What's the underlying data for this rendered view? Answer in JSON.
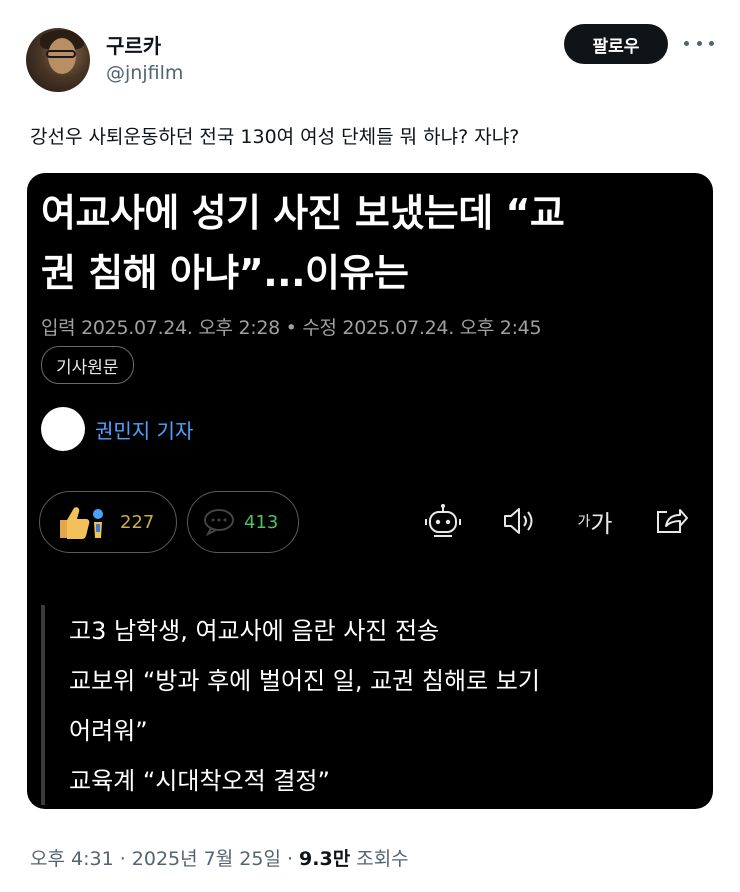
{
  "author": {
    "display_name": "구르카",
    "handle": "@jnjfilm"
  },
  "follow_label": "팔로우",
  "tweet_text": "강선우 사퇴운동하던 전국 130여 여성 단체들 뭐 하냐? 자냐?",
  "article": {
    "headline_line1": "여교사에 성기 사진 보냈는데 “교",
    "headline_line2": "권 침해 아냐”...이유는",
    "meta": "입력 2025.07.24. 오후 2:28 • 수정 2025.07.24. 오후 2:45",
    "source_label": "기사원문",
    "reporter": "권민지 기자",
    "like_count": "227",
    "comment_count": "413",
    "font_label_small": "가",
    "font_label_large": "가",
    "summary": [
      "고3 남학생, 여교사에 음란 사진 전송",
      "교보위 “방과 후에 벌어진 일, 교권 침해로 보기",
      "어려워”",
      "교육계 “시대착오적 결정”"
    ]
  },
  "footer": {
    "time": "오후 4:31 · 2025년 7월 25일 · ",
    "views": "9.3만",
    "views_label": " 조회수"
  }
}
